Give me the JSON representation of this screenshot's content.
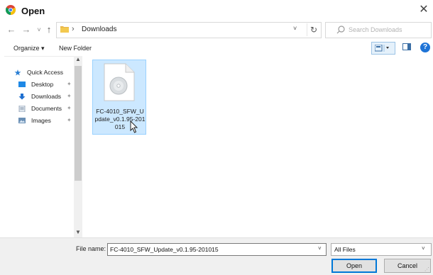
{
  "window": {
    "title": "Open",
    "close_glyph": "✕",
    "app_icon": "chrome-icon"
  },
  "nav": {
    "back_glyph": "←",
    "forward_glyph": "→",
    "recent_glyph": "˅",
    "up_glyph": "↑",
    "breadcrumb_sep": "›",
    "address": "Downloads",
    "address_drop_glyph": "˅",
    "refresh_glyph": "↻",
    "search_placeholder": "Search Downloads"
  },
  "commands": {
    "organize": "Organize ▾",
    "new_folder": "New Folder",
    "help_glyph": "?"
  },
  "sidebar": {
    "items": [
      {
        "label": "Quick Access",
        "icon": "star-icon"
      },
      {
        "label": "Desktop",
        "icon": "desktop-icon",
        "pinned": true
      },
      {
        "label": "Downloads",
        "icon": "download-icon",
        "pinned": true
      },
      {
        "label": "Documents",
        "icon": "documents-icon",
        "pinned": true
      },
      {
        "label": "Images",
        "icon": "images-icon",
        "pinned": true
      }
    ],
    "pin_glyph": "📌"
  },
  "files": [
    {
      "name": "FC-4010_SFW_Update_v0.1.95-201015",
      "icon": "disc-image-file-icon",
      "selected": true
    }
  ],
  "footer": {
    "file_name_label": "File name:",
    "file_name_value": "FC-4010_SFW_Update_v0.1.95-201015",
    "file_type": "All Files",
    "open_label": "Open",
    "cancel_label": "Cancel"
  },
  "colors": {
    "selection": "#cce8ff",
    "accent": "#0078d7",
    "help": "#1e73d6"
  }
}
